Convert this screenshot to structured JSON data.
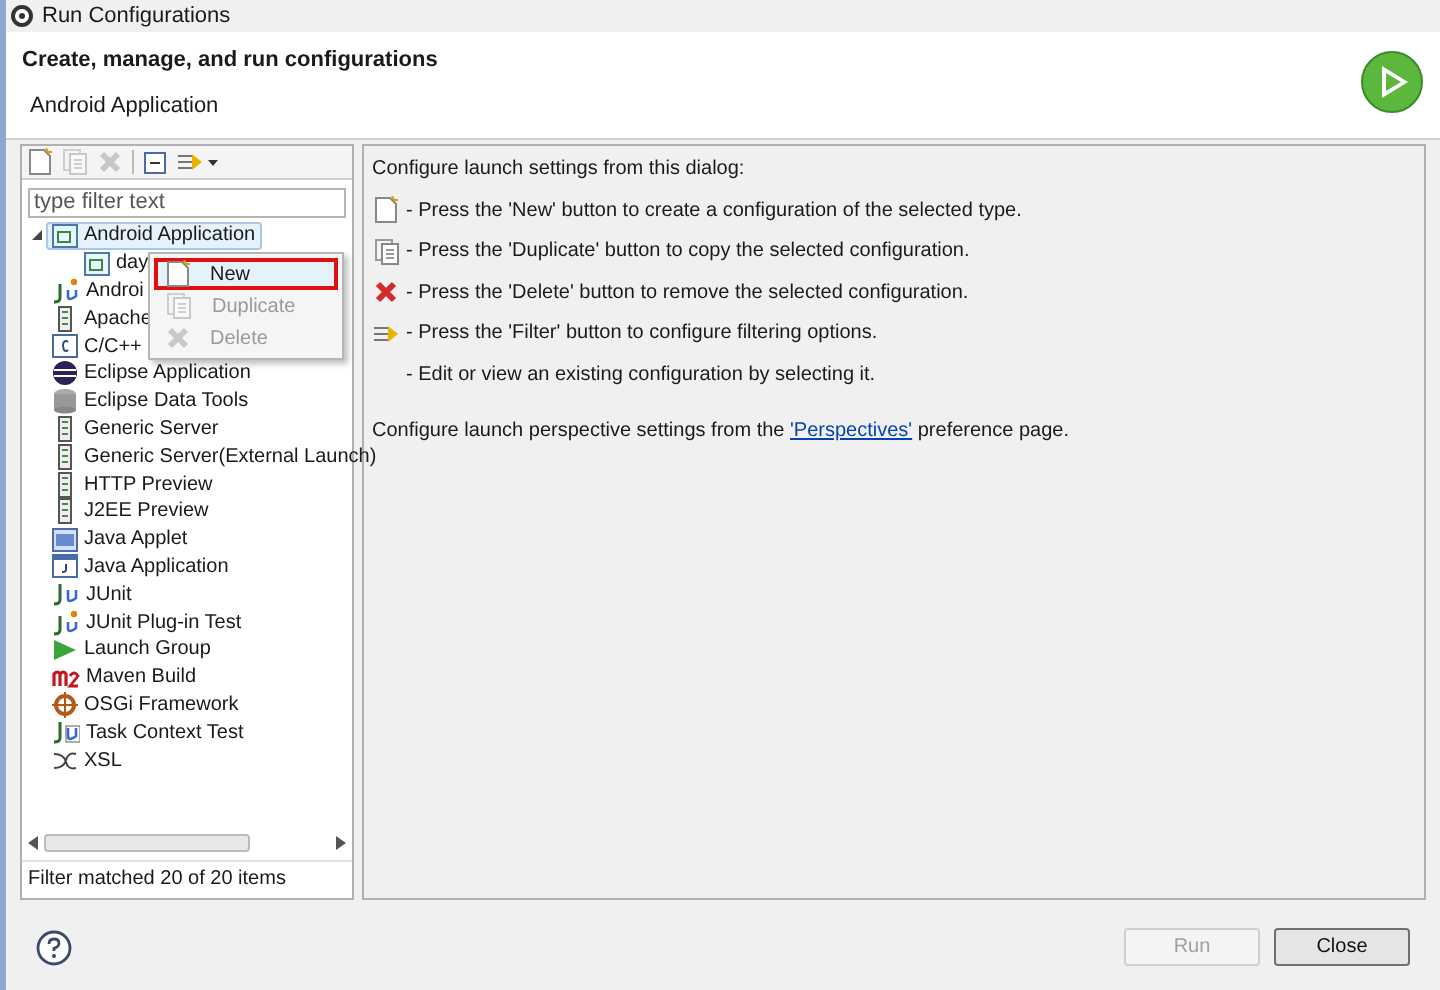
{
  "window": {
    "title": "Run Configurations"
  },
  "header": {
    "title": "Create, manage, and run configurations",
    "subtitle": "Android Application"
  },
  "filter": {
    "placeholder": "type filter text"
  },
  "tree": [
    {
      "label": "Android Application",
      "kind": "android",
      "selected": true,
      "expanded": true,
      "children": [
        {
          "label": "day",
          "kind": "android",
          "selected": false
        }
      ]
    },
    {
      "label": "Androi",
      "kind": "junit-plugin",
      "selected": false
    },
    {
      "label": "Apache",
      "kind": "server",
      "selected": false
    },
    {
      "label": "C/C++",
      "kind": "cpp",
      "selected": false
    },
    {
      "label": "Eclipse Application",
      "kind": "eclipse",
      "selected": false
    },
    {
      "label": "Eclipse Data Tools",
      "kind": "db",
      "selected": false
    },
    {
      "label": "Generic Server",
      "kind": "server",
      "selected": false
    },
    {
      "label": "Generic Server(External Launch)",
      "kind": "server",
      "selected": false
    },
    {
      "label": "HTTP Preview",
      "kind": "server",
      "selected": false
    },
    {
      "label": "J2EE Preview",
      "kind": "server",
      "selected": false
    },
    {
      "label": "Java Applet",
      "kind": "applet",
      "selected": false
    },
    {
      "label": "Java Application",
      "kind": "java",
      "selected": false
    },
    {
      "label": "JUnit",
      "kind": "junit",
      "selected": false
    },
    {
      "label": "JUnit Plug-in Test",
      "kind": "junit-plugin",
      "selected": false
    },
    {
      "label": "Launch Group",
      "kind": "launch",
      "selected": false
    },
    {
      "label": "Maven Build",
      "kind": "maven",
      "selected": false
    },
    {
      "label": "OSGi Framework",
      "kind": "osgi",
      "selected": false
    },
    {
      "label": "Task Context Test",
      "kind": "task",
      "selected": false
    },
    {
      "label": "XSL",
      "kind": "xsl",
      "selected": false
    }
  ],
  "context_menu": [
    {
      "label": "New",
      "kind": "new",
      "disabled": false,
      "selected": true
    },
    {
      "label": "Duplicate",
      "kind": "duplicate",
      "disabled": true,
      "selected": false
    },
    {
      "label": "Delete",
      "kind": "delete",
      "disabled": true,
      "selected": false
    }
  ],
  "filter_status": "Filter matched 20 of 20 items",
  "info": {
    "intro": "Configure launch settings from this dialog:",
    "lines": [
      {
        "kind": "new",
        "text": "- Press the 'New' button to create a configuration of the selected type."
      },
      {
        "kind": "duplicate",
        "text": "- Press the 'Duplicate' button to copy the selected configuration."
      },
      {
        "kind": "delete",
        "text": "- Press the 'Delete' button to remove the selected configuration."
      },
      {
        "kind": "filter",
        "text": "- Press the 'Filter' button to configure filtering options."
      },
      {
        "kind": "none",
        "text": "- Edit or view an existing configuration by selecting it."
      }
    ],
    "perspective_before": "Configure launch perspective settings from the",
    "perspective_link": "'Perspectives'",
    "perspective_after": "preference page."
  },
  "buttons": [
    {
      "label": "Run",
      "disabled": true
    },
    {
      "label": "Close",
      "disabled": false
    }
  ]
}
